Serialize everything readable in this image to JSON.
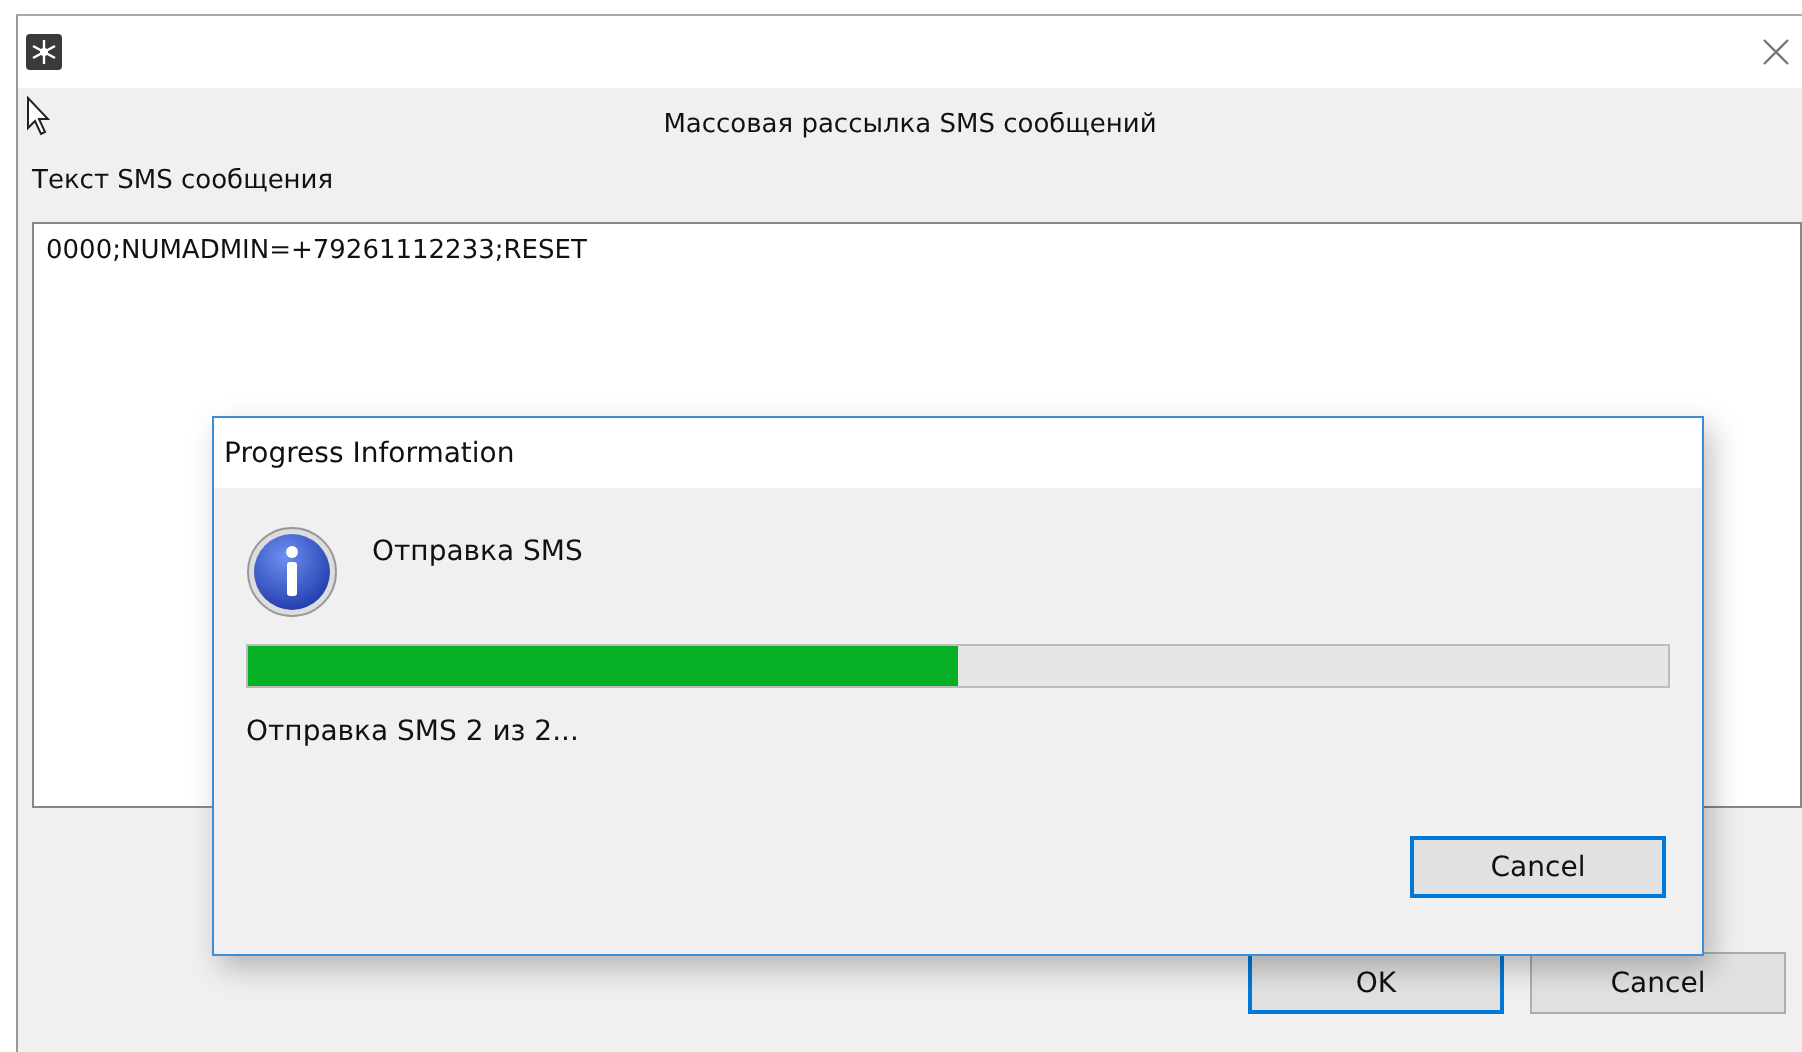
{
  "main_window": {
    "heading": "Массовая рассылка SMS сообщений",
    "message_label": "Текст SMS сообщения",
    "message_text": "0000;NUMADMIN=+79261112233;RESET",
    "buttons": [
      {
        "label": "OK",
        "default": true
      },
      {
        "label": "Cancel",
        "default": false
      }
    ]
  },
  "progress_dialog": {
    "title": "Progress Information",
    "caption": "Отправка SMS",
    "level": 0.5,
    "status": "Отправка SMS 2 из 2...",
    "buttons": [
      {
        "label": "Cancel",
        "default": true
      }
    ]
  }
}
